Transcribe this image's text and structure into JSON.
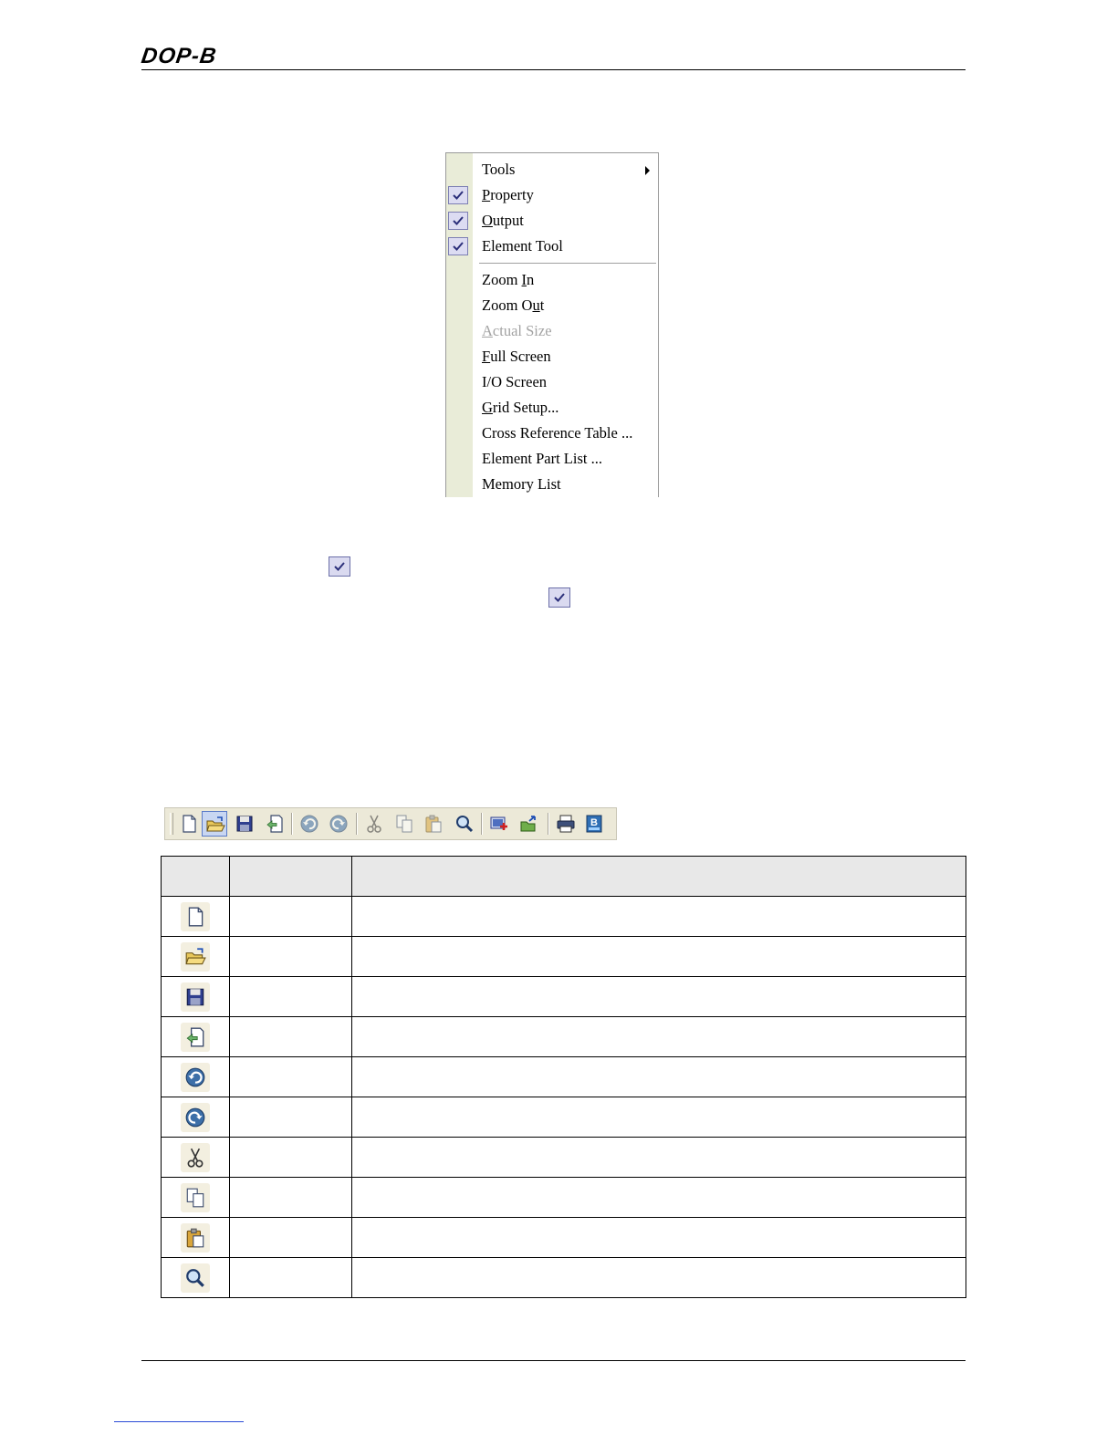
{
  "header": {
    "brand": "DOP-B"
  },
  "menu": {
    "items": [
      {
        "label": "Tools",
        "checked": false,
        "disabled": false,
        "submenu": true,
        "mnemonic": ""
      },
      {
        "label": "Property",
        "checked": true,
        "disabled": false,
        "submenu": false,
        "mnemonic": "P"
      },
      {
        "label": "Output",
        "checked": true,
        "disabled": false,
        "submenu": false,
        "mnemonic": "O"
      },
      {
        "label": "Element Tool",
        "checked": true,
        "disabled": false,
        "submenu": false,
        "mnemonic": ""
      },
      {
        "label": "Zoom In",
        "checked": false,
        "disabled": false,
        "submenu": false,
        "mnemonic": "I"
      },
      {
        "label": "Zoom Out",
        "checked": false,
        "disabled": false,
        "submenu": false,
        "mnemonic": "u"
      },
      {
        "label": "Actual Size",
        "checked": false,
        "disabled": true,
        "submenu": false,
        "mnemonic": "A"
      },
      {
        "label": "Full Screen",
        "checked": false,
        "disabled": false,
        "submenu": false,
        "mnemonic": "F"
      },
      {
        "label": "I/O Screen",
        "checked": false,
        "disabled": false,
        "submenu": false,
        "mnemonic": ""
      },
      {
        "label": "Grid Setup...",
        "checked": false,
        "disabled": false,
        "submenu": false,
        "mnemonic": "G"
      },
      {
        "label": "Cross Reference Table ...",
        "checked": false,
        "disabled": false,
        "submenu": false,
        "mnemonic": ""
      },
      {
        "label": "Element Part List ...",
        "checked": false,
        "disabled": false,
        "submenu": false,
        "mnemonic": ""
      },
      {
        "label": "Memory List",
        "checked": false,
        "disabled": false,
        "submenu": false,
        "mnemonic": ""
      }
    ]
  },
  "toolbar": {
    "buttons": [
      {
        "icon": "new-file-icon",
        "state": "normal"
      },
      {
        "icon": "open-folder-icon",
        "state": "pressed"
      },
      {
        "icon": "save-icon",
        "state": "normal"
      },
      {
        "icon": "close-file-icon",
        "state": "normal"
      },
      {
        "icon": "undo-icon",
        "state": "disabled"
      },
      {
        "icon": "redo-icon",
        "state": "disabled"
      },
      {
        "icon": "cut-icon",
        "state": "disabled"
      },
      {
        "icon": "copy-icon",
        "state": "disabled"
      },
      {
        "icon": "paste-icon",
        "state": "disabled"
      },
      {
        "icon": "find-icon",
        "state": "normal"
      },
      {
        "icon": "import-icon",
        "state": "normal"
      },
      {
        "icon": "export-icon",
        "state": "normal"
      },
      {
        "icon": "print-icon",
        "state": "normal"
      },
      {
        "icon": "build-icon",
        "state": "normal"
      }
    ]
  },
  "table": {
    "header": [
      "",
      "",
      ""
    ],
    "rows": [
      {
        "icon": "new-file-icon",
        "name": "",
        "description": ""
      },
      {
        "icon": "open-folder-icon",
        "name": "",
        "description": ""
      },
      {
        "icon": "save-icon",
        "name": "",
        "description": ""
      },
      {
        "icon": "close-file-icon",
        "name": "",
        "description": ""
      },
      {
        "icon": "undo-icon",
        "name": "",
        "description": ""
      },
      {
        "icon": "redo-icon",
        "name": "",
        "description": ""
      },
      {
        "icon": "cut-icon",
        "name": "",
        "description": ""
      },
      {
        "icon": "copy-icon",
        "name": "",
        "description": ""
      },
      {
        "icon": "paste-icon",
        "name": "",
        "description": ""
      },
      {
        "icon": "find-icon",
        "name": "",
        "description": ""
      }
    ]
  },
  "colors": {
    "menu_gutter": "#e9ecd8",
    "check_fill": "#dcdcf2",
    "toolbar_bg": "#ece9d8",
    "table_header_bg": "#e8e8e8",
    "disabled_text": "#a3a3a3"
  }
}
